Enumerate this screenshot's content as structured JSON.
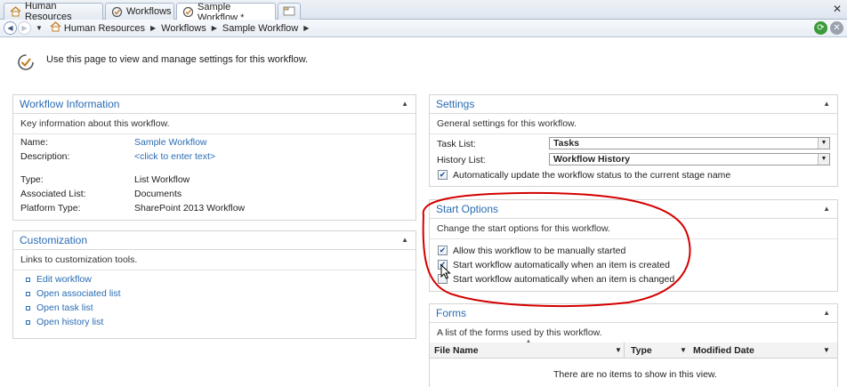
{
  "tabs": [
    {
      "label": "Human Resources",
      "icon": "home-icon"
    },
    {
      "label": "Workflows",
      "icon": "workflow-icon"
    },
    {
      "label": "Sample Workflow *",
      "icon": "workflow-icon",
      "active": true
    }
  ],
  "breadcrumb": [
    "Human Resources",
    "Workflows",
    "Sample Workflow"
  ],
  "page": {
    "description": "Use this page to view and manage settings for this workflow."
  },
  "workflow_info": {
    "title": "Workflow Information",
    "desc": "Key information about this workflow.",
    "name_label": "Name:",
    "name_value": "Sample Workflow",
    "description_label": "Description:",
    "description_value": "<click to enter text>",
    "type_label": "Type:",
    "type_value": "List Workflow",
    "associated_label": "Associated List:",
    "associated_value": "Documents",
    "platform_label": "Platform Type:",
    "platform_value": "SharePoint 2013 Workflow"
  },
  "customization": {
    "title": "Customization",
    "desc": "Links to customization tools.",
    "links": [
      "Edit workflow",
      "Open associated list",
      "Open task list",
      "Open history list"
    ]
  },
  "settings": {
    "title": "Settings",
    "desc": "General settings for this workflow.",
    "task_list_label": "Task List:",
    "task_list_value": "Tasks",
    "history_list_label": "History List:",
    "history_list_value": "Workflow History",
    "auto_update_label": "Automatically update the workflow status to the current stage name",
    "auto_update_checked": true
  },
  "start_options": {
    "title": "Start Options",
    "desc": "Change the start options for this workflow.",
    "options": [
      {
        "label": "Allow this workflow to be manually started",
        "checked": true
      },
      {
        "label": "Start workflow automatically when an item is created",
        "checked": true
      },
      {
        "label": "Start workflow automatically when an item is changed",
        "checked": false
      }
    ]
  },
  "forms": {
    "title": "Forms",
    "desc": "A list of the forms used by this workflow.",
    "columns": [
      "File Name",
      "Type",
      "Modified Date"
    ],
    "empty_message": "There are no items to show in this view."
  },
  "colors": {
    "accent": "#2a6cb3",
    "annotation": "#d40000"
  }
}
